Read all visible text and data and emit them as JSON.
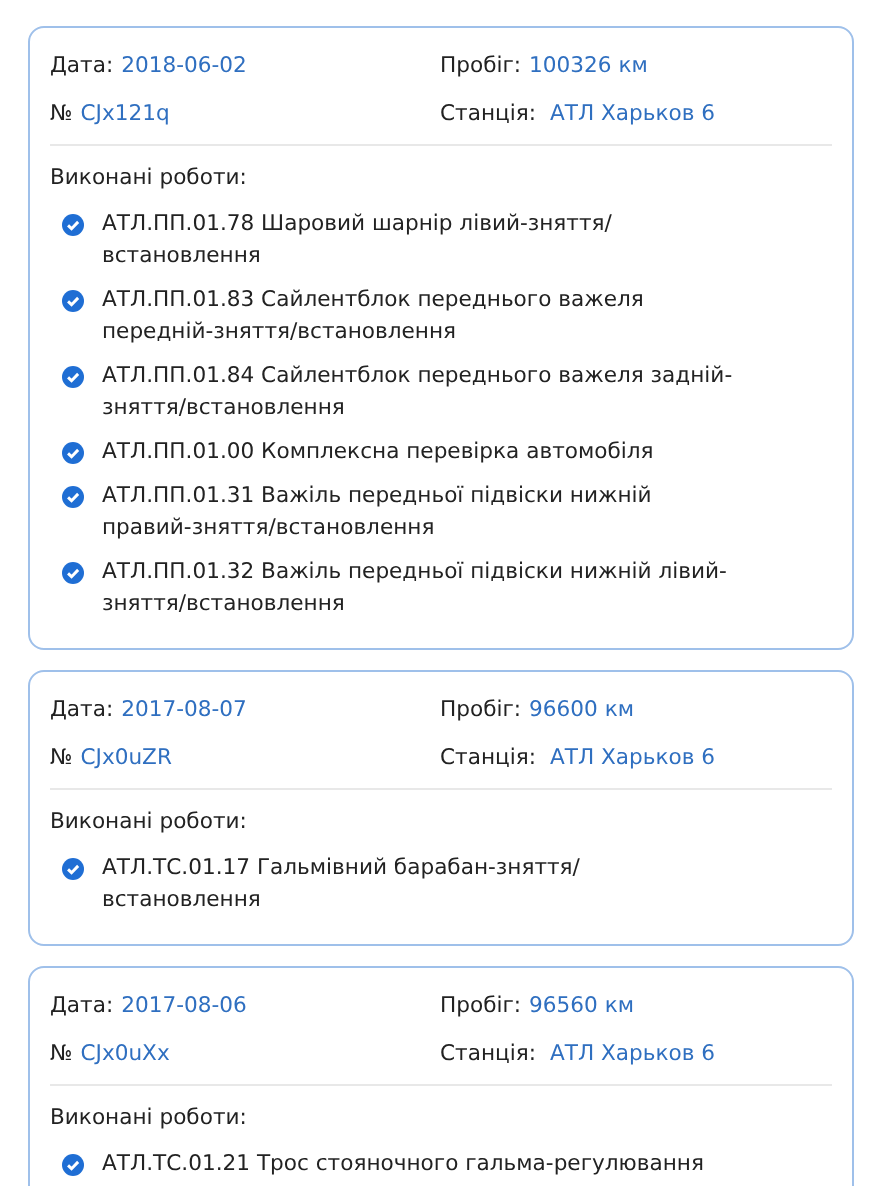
{
  "records": [
    {
      "date_label": "Дата:",
      "date": "2018-06-02",
      "mileage_label": "Пробіг:",
      "mileage": "100326 км",
      "number_label": "№",
      "number": "CJx121q",
      "station_label": "Станція:",
      "station": "АТЛ Харьков 6",
      "works_label": "Виконані роботи:",
      "works": [
        {
          "text": "АТЛ.ПП.01.78 Шаровий шарнір лівий-зняття/встановлення",
          "done": true
        },
        {
          "text": "АТЛ.ПП.01.83 Сайлентблок переднього важеля передній-зняття/встановлення",
          "done": true
        },
        {
          "text": "АТЛ.ПП.01.84 Сайлентблок переднього важеля задній-зняття/встановлення",
          "done": true
        },
        {
          "text": "АТЛ.ПП.01.00 Комплексна перевірка автомобіля",
          "done": true
        },
        {
          "text": "АТЛ.ПП.01.31 Важіль передньої підвіски нижній правий-зняття/встановлення",
          "done": true
        },
        {
          "text": "АТЛ.ПП.01.32 Важіль передньої підвіски нижній лівий-зняття/встановлення",
          "done": true
        }
      ]
    },
    {
      "date_label": "Дата:",
      "date": "2017-08-07",
      "mileage_label": "Пробіг:",
      "mileage": "96600 км",
      "number_label": "№",
      "number": "CJx0uZR",
      "station_label": "Станція:",
      "station": "АТЛ Харьков 6",
      "works_label": "Виконані роботи:",
      "works": [
        {
          "text": "АТЛ.ТС.01.17 Гальмівний барабан-зняття/встановлення",
          "done": true
        }
      ]
    },
    {
      "date_label": "Дата:",
      "date": "2017-08-06",
      "mileage_label": "Пробіг:",
      "mileage": "96560 км",
      "number_label": "№",
      "number": "CJx0uXx",
      "station_label": "Станція:",
      "station": "АТЛ Харьков 6",
      "works_label": "Виконані роботи:",
      "works": [
        {
          "text": "АТЛ.ТС.01.21 Трос стояночного гальма-регулювання",
          "done": true
        }
      ]
    }
  ]
}
